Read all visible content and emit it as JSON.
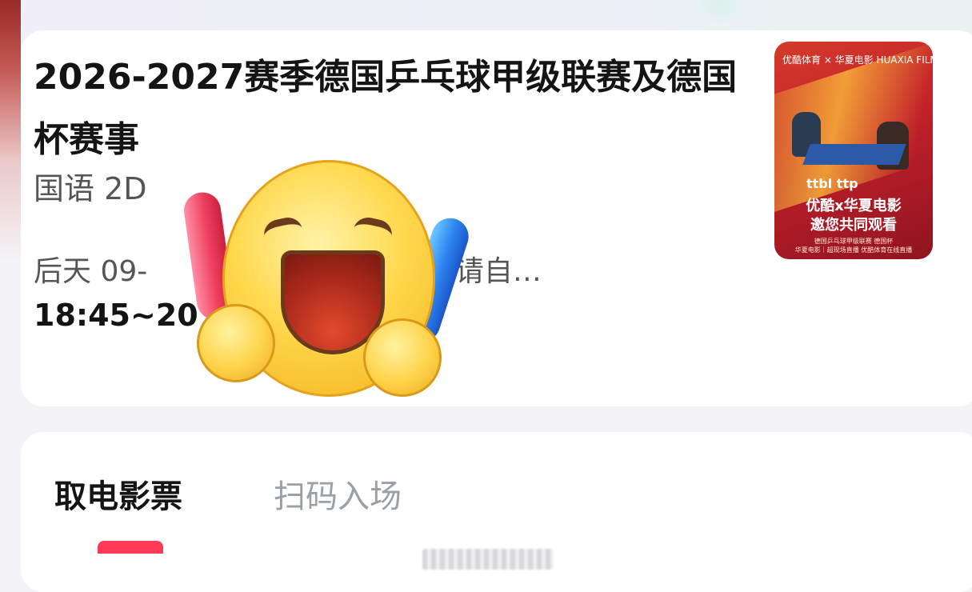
{
  "movie": {
    "title": "2026-2027赛季德国乒乓球甲级联赛及德国杯赛事",
    "language": "国语 2D",
    "show_info": "后天 09-",
    "hall": "厅（3D眼镜请自…",
    "time": "18:45~20"
  },
  "poster": {
    "brand": "优酷体育 × 华夏电影 HUAXIA FILM",
    "logos": "ttbl  ttp",
    "headline_1": "优酷x华夏电影",
    "headline_2": "邀您共同观看",
    "fine_1": "德国乒乓球甲级联赛  德国杯",
    "fine_2": "华夏电影｜超现场直播  优酷体育在线直播"
  },
  "tabs": {
    "pickup": "取电影票",
    "scan": "扫码入场"
  },
  "colors": {
    "accent": "#ff3a58",
    "title": "#141414",
    "secondary": "#555555",
    "inactive_tab": "#9aa0a8"
  }
}
